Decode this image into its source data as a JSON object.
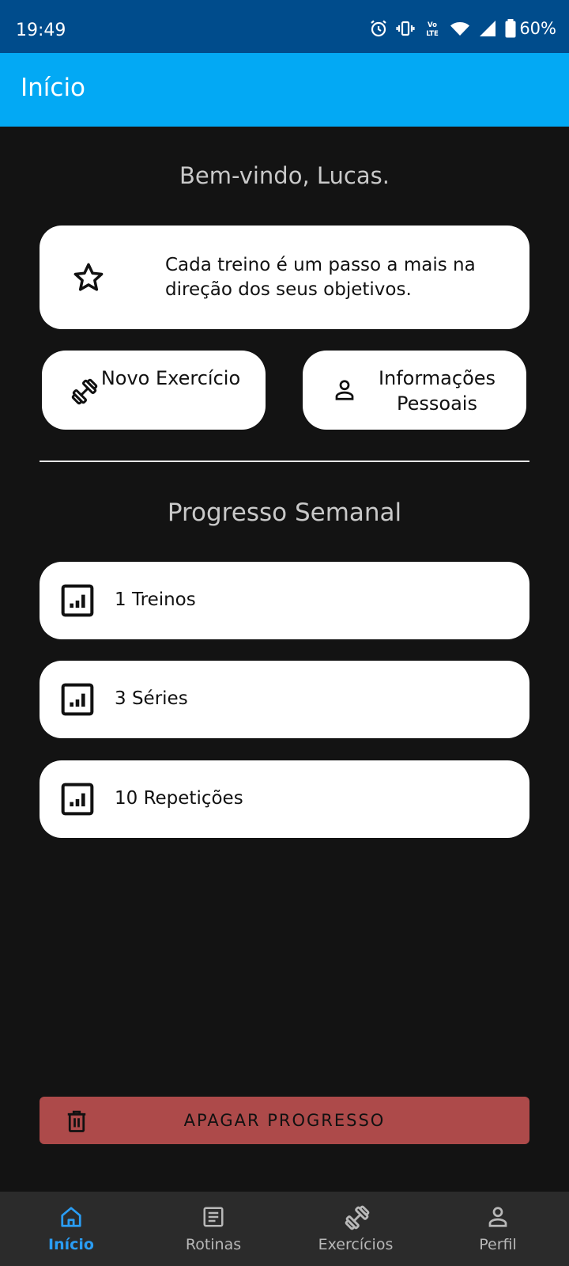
{
  "status_bar": {
    "time": "19:49",
    "battery": "60%",
    "icons": [
      "alarm-icon",
      "vibrate-icon",
      "volte-icon",
      "wifi-icon",
      "signal-icon",
      "battery-icon"
    ]
  },
  "app_bar": {
    "title": "Início"
  },
  "welcome": "Bem-vindo, Lucas.",
  "motivation": {
    "text": "Cada treino é um passo a mais na direção dos seus objetivos.",
    "icon": "star-icon"
  },
  "actions": [
    {
      "label": "Novo Exercício",
      "icon": "dumbbell-icon"
    },
    {
      "label": "Informações Pessoais",
      "icon": "person-icon"
    }
  ],
  "progress": {
    "title": "Progresso Semanal",
    "items": [
      {
        "label": "1 Treinos",
        "icon": "chart-icon"
      },
      {
        "label": "3 Séries",
        "icon": "chart-icon"
      },
      {
        "label": "10 Repetições",
        "icon": "chart-icon"
      }
    ]
  },
  "delete_button": {
    "label": "APAGAR PROGRESSO",
    "icon": "trash-icon"
  },
  "bottom_nav": {
    "items": [
      {
        "label": "Início",
        "icon": "home-icon",
        "active": true
      },
      {
        "label": "Rotinas",
        "icon": "list-icon",
        "active": false
      },
      {
        "label": "Exercícios",
        "icon": "dumbbell-icon",
        "active": false
      },
      {
        "label": "Perfil",
        "icon": "person-icon",
        "active": false
      }
    ]
  },
  "colors": {
    "status_bar": "#004c8c",
    "app_bar": "#03a9f4",
    "background": "#131313",
    "card": "#ffffff",
    "delete": "#ad4a4a",
    "nav_active": "#2a9df4",
    "nav_bg": "#2b2b2b"
  }
}
